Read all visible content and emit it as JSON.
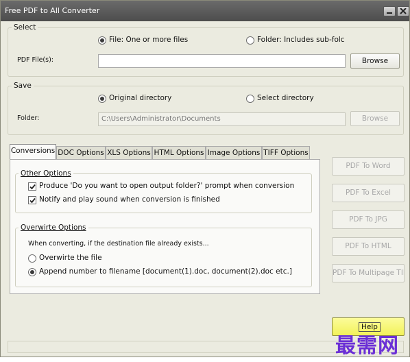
{
  "window": {
    "title": "Free PDF to All Converter"
  },
  "select_group": {
    "label": "Select",
    "file_radio": "File:  One or more files",
    "folder_radio": "Folder: Includes sub-folc",
    "pdf_files_label": "PDF File(s):",
    "pdf_files_value": "",
    "browse": "Browse"
  },
  "save_group": {
    "label": "Save",
    "original_radio": "Original directory",
    "select_radio": "Select directory",
    "folder_label": "Folder:",
    "folder_value": "C:\\Users\\Administrator\\Documents",
    "browse": "Browse"
  },
  "tabs": [
    "Conversions",
    "DOC Options",
    "XLS Options",
    "HTML Options",
    "Image Options",
    "TIFF Options"
  ],
  "other_options": {
    "label": "Other Options",
    "prompt_check": "Produce 'Do you want to open output folder?' prompt when conversion is finis",
    "sound_check": "Notify and play sound when conversion is finished"
  },
  "overwrite_options": {
    "label": "Overwirte Options",
    "desc": "When converting, if the destination file already exists...",
    "overwrite_radio": "Overwirte the file",
    "append_radio": "Append number to filename  [document(1).doc, document(2).doc etc.]"
  },
  "actions": {
    "to_word": "PDF To Word",
    "to_excel": "PDF To Excel",
    "to_jpg": "PDF To JPG",
    "to_html": "PDF To HTML",
    "to_tiff": "PDF To Multipage TIFF",
    "help": "Help"
  },
  "watermark": "最需网"
}
